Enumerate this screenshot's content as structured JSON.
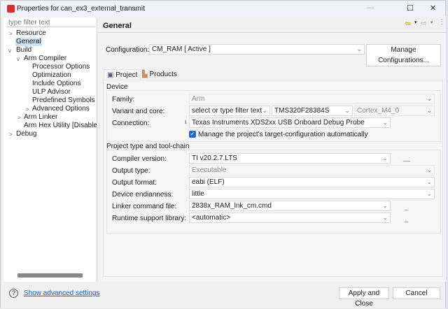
{
  "window": {
    "title": "Properties for can_ex3_external_transmit",
    "minimize": "—",
    "maximize": "☐",
    "close": "✕"
  },
  "sidebar": {
    "filter_placeholder": "type filter text",
    "items": [
      "Resource",
      "General",
      "Build",
      "Arm Compiler",
      "Processor Options",
      "Optimization",
      "Include Options",
      "ULP Advisor",
      "Predefined Symbols",
      "Advanced Options",
      "Arm Linker",
      "Arm Hex Utility  [Disabled]",
      "Debug"
    ]
  },
  "header": {
    "title": "General"
  },
  "config": {
    "label": "Configuration:",
    "value": "CM_RAM  [ Active ]",
    "manage": "Manage Configurations..."
  },
  "tabs": [
    "Project",
    "Products"
  ],
  "device": {
    "title": "Device",
    "family_label": "Family:",
    "family": "Arm",
    "variant_label": "Variant and core:",
    "variant_filter": "select or type filter text>",
    "variant": "TMS320F28384S",
    "core": "Cortex_M4_0",
    "connection_label": "Connection:",
    "connection": "Texas Instruments XDS2xx USB Onboard Debug Probe",
    "manage_label": "Manage the project's target-configuration automatically",
    "manage_checked": true
  },
  "toolchain": {
    "title": "Project type and tool-chain",
    "compiler_label": "Compiler version:",
    "compiler": "TI v20.2.7.LTS",
    "output_type_label": "Output type:",
    "output_type": "Executable",
    "output_format_label": "Output format:",
    "output_format": "eabi (ELF)",
    "endian_label": "Device endianness:",
    "endian": "little",
    "linker_label": "Linker command file:",
    "linker": "2838x_RAM_lnk_cm.cmd",
    "rts_label": "Runtime support library:",
    "rts": "<automatic>"
  },
  "footer": {
    "help": "?",
    "advanced": "Show advanced settings",
    "apply": "Apply and Close",
    "cancel": "Cancel"
  }
}
